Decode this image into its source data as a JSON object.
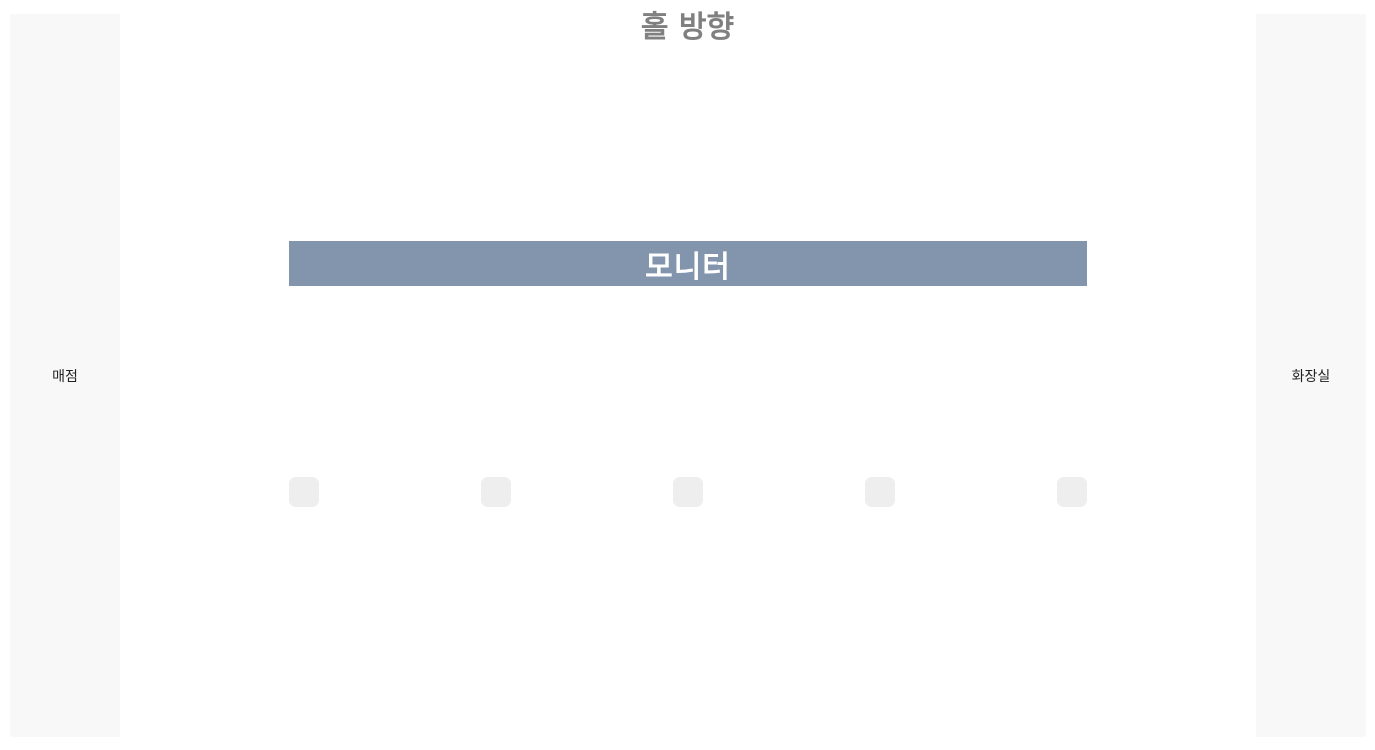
{
  "hall": {
    "title": "홀 방향"
  },
  "left_area": {
    "label": "매점"
  },
  "right_area": {
    "label": "화장실"
  },
  "monitor": {
    "label": "모니터",
    "color": "#8295ad"
  },
  "seats": [
    {
      "label": ""
    },
    {
      "label": ""
    },
    {
      "label": ""
    },
    {
      "label": ""
    },
    {
      "label": ""
    }
  ],
  "colors": {
    "side_area": "#f8f8f8",
    "seat": "#eeeeee",
    "title": "#808080"
  }
}
